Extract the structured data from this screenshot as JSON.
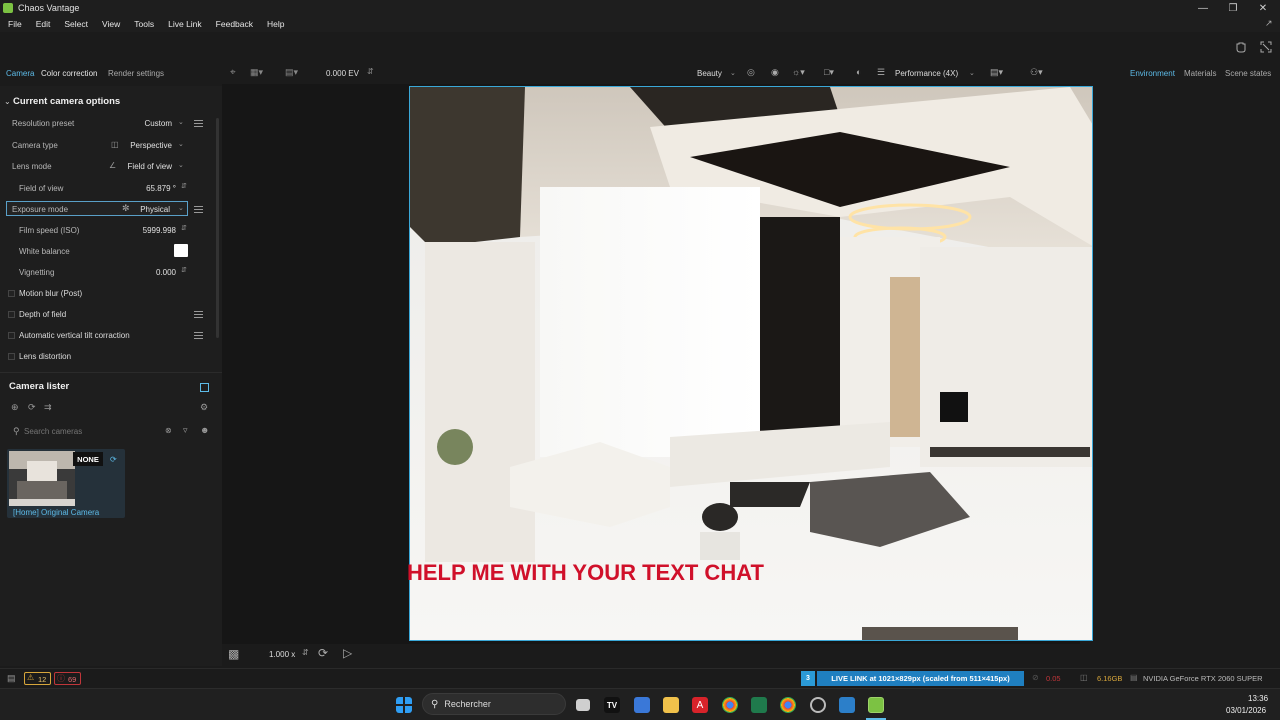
{
  "window": {
    "title": "Chaos Vantage"
  },
  "menu": [
    "File",
    "Edit",
    "Select",
    "View",
    "Tools",
    "Live Link",
    "Feedback",
    "Help"
  ],
  "subtabs": [
    {
      "label": "Camera",
      "active": true
    },
    {
      "label": "Color correction",
      "active": false
    },
    {
      "label": "Render settings",
      "active": false
    }
  ],
  "viewport_toolbar": {
    "exposure_value": "0.000 EV",
    "render_mode": "Beauty",
    "quality": "Performance (4X)"
  },
  "right_tabs": [
    {
      "label": "Environment",
      "active": true
    },
    {
      "label": "Materials",
      "active": false
    },
    {
      "label": "Scene states",
      "active": false
    }
  ],
  "camera_options": {
    "title": "Current camera options",
    "resolution_preset": {
      "label": "Resolution preset",
      "value": "Custom"
    },
    "camera_type": {
      "label": "Camera type",
      "value": "Perspective"
    },
    "lens_mode": {
      "label": "Lens mode",
      "value": "Field of view"
    },
    "field_of_view": {
      "label": "Field of view",
      "value": "65.879 °"
    },
    "exposure_mode": {
      "label": "Exposure mode",
      "value": "Physical"
    },
    "film_speed": {
      "label": "Film speed (ISO)",
      "value": "5999.998"
    },
    "white_balance": {
      "label": "White balance"
    },
    "vignetting": {
      "label": "Vignetting",
      "value": "0.000"
    },
    "motion_blur": {
      "label": "Motion blur (Post)"
    },
    "depth_of_field": {
      "label": "Depth of field"
    },
    "tilt_correction": {
      "label": "Automatic vertical tilt corraction"
    },
    "lens_distortion": {
      "label": "Lens distortion"
    }
  },
  "camera_lister": {
    "title": "Camera lister",
    "search_placeholder": "Search cameras",
    "cameras": [
      {
        "name": "[Home] Original Camera",
        "badge": "NONE"
      }
    ]
  },
  "overlay_text": "HELP ME WITH YOUR TEXT CHAT",
  "bottom_bar": {
    "speed": "1.000 x"
  },
  "status": {
    "warnings": "12",
    "errors": "69",
    "livelink_count": "3",
    "livelink_text": "LIVE LINK at 1021×829px (scaled from 511×415px)",
    "fps": "0.05",
    "memory": "6.16GB",
    "gpu": "NVIDIA GeForce RTX 2060 SUPER"
  },
  "taskbar": {
    "search_label": "Rechercher",
    "time": "13:36",
    "date": "03/01/2026"
  },
  "colors": {
    "accent": "#5dbbe8",
    "livelink": "#1f7fc0",
    "overlay": "#d0102a",
    "brand": "#7cc243"
  }
}
